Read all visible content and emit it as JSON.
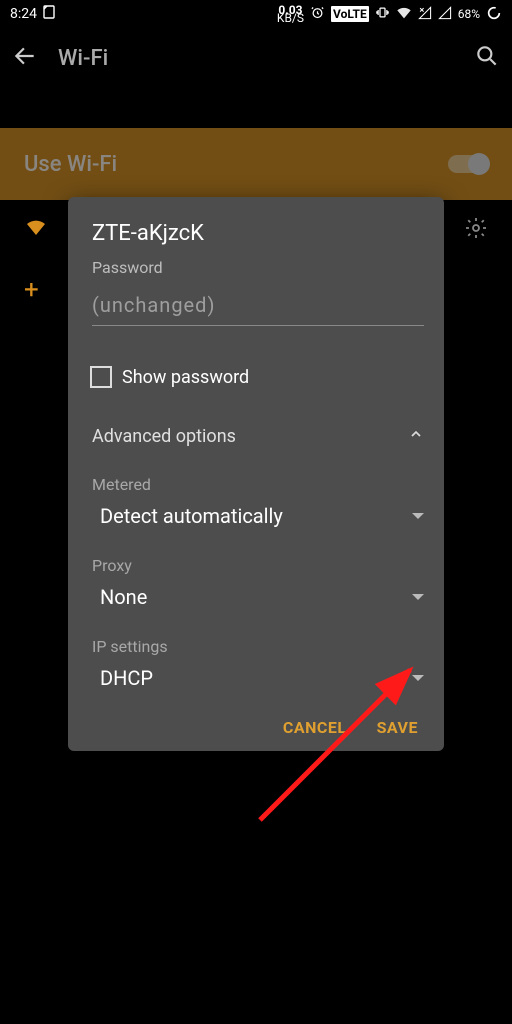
{
  "status": {
    "time": "8:24",
    "data_rate_top": "0.03",
    "data_rate_bottom": "KB/S",
    "volte": "VoLTE",
    "battery": "68%"
  },
  "header": {
    "title": "Wi-Fi"
  },
  "banner": {
    "use_wifi_label": "Use Wi-Fi"
  },
  "dialog": {
    "ssid": "ZTE-aKjzcK",
    "password_label": "Password",
    "password_placeholder": "(unchanged)",
    "show_password_label": "Show password",
    "advanced_label": "Advanced options",
    "metered": {
      "label": "Metered",
      "value": "Detect automatically"
    },
    "proxy": {
      "label": "Proxy",
      "value": "None"
    },
    "ip": {
      "label": "IP settings",
      "value": "DHCP"
    },
    "cancel": "CANCEL",
    "save": "SAVE"
  }
}
